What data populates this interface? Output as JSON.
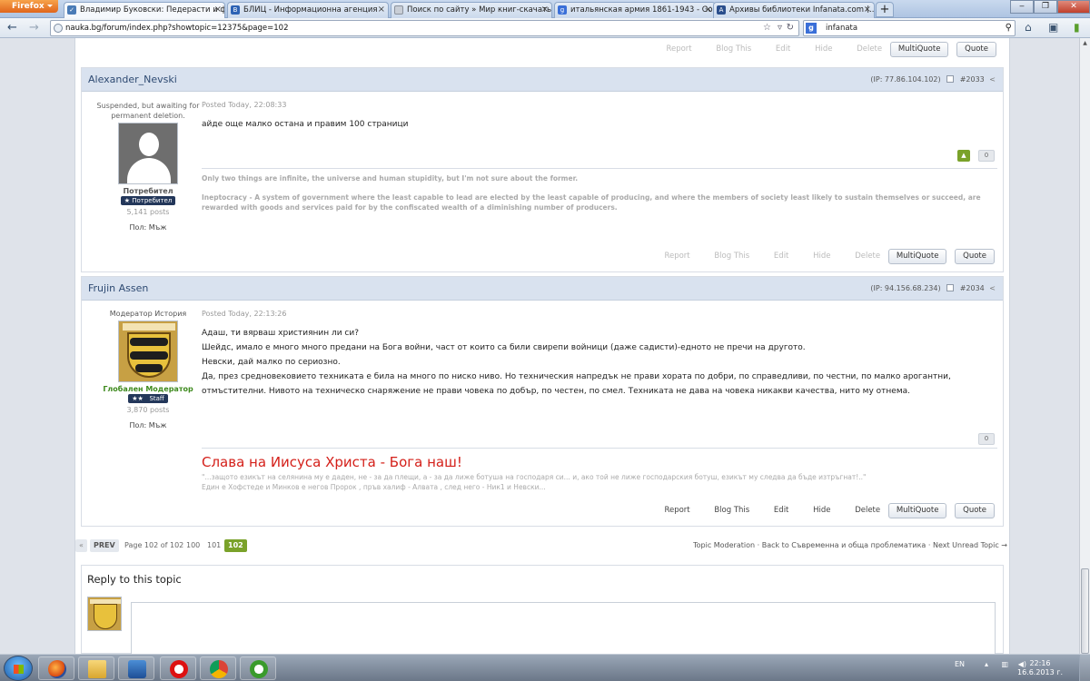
{
  "browser": {
    "app_button": "Firefox",
    "tabs": [
      {
        "label": "Владимир Буковски: Педерасти и ф...",
        "active": true
      },
      {
        "label": "БЛИЦ - Информационна агенция",
        "active": false
      },
      {
        "label": "Поиск по сайту » Мир книг-скачать...",
        "active": false
      },
      {
        "label": "итальянская армия 1861-1943 - Goo...",
        "active": false
      },
      {
        "label": "Архивы библиотеки Infanata.com (...",
        "active": false
      }
    ],
    "url": "nauka.bg/forum/index.php?showtopic=12375&page=102",
    "search_value": "infanata",
    "search_engine_icon": "google-icon"
  },
  "top_actions": {
    "report": "Report",
    "blog": "Blog This",
    "edit": "Edit",
    "hide": "Hide",
    "delete": "Delete",
    "multiquote": "MultiQuote",
    "quote": "Quote"
  },
  "posts": [
    {
      "author": "Alexander_Nevski",
      "ip": "(IP: 77.86.104.102)",
      "number": "#2033",
      "status": "Suspended, but awaiting for permanent deletion.",
      "group": "Потребител",
      "badge": "Потребител",
      "post_count": "5,141 posts",
      "gender": "Пол: Мъж",
      "posted": "Posted Today, 22:08:33",
      "lines": [
        "айде още малко остана и правим 100 страници"
      ],
      "rep_count": "0",
      "signature": [
        "Only two things are infinite, the universe and human stupidity, but I'm not sure about the former.",
        "Ineptocracy - A system of government where the least capable to lead are elected by the least capable of producing, and where the members of society least likely to sustain themselves or succeed, are rewarded with goods and services paid for by the confiscated wealth of a diminishing number of producers."
      ],
      "actions": {
        "report": "Report",
        "blog": "Blog This",
        "edit": "Edit",
        "hide": "Hide",
        "delete": "Delete",
        "multiquote": "MultiQuote",
        "quote": "Quote"
      }
    },
    {
      "author": "Frujin Assen",
      "ip": "(IP: 94.156.68.234)",
      "number": "#2034",
      "title": "Модератор История",
      "group": "Глобален Модератор",
      "badge": "Staff",
      "post_count": "3,870 posts",
      "gender": "Пол: Мъж",
      "posted": "Posted Today, 22:13:26",
      "lines": [
        "Адаш, ти вярваш християнин ли си?",
        "Шейдс, имало е много много предани на Бога войни, част от които са били свирепи войници (даже садисти)-едното не пречи на другото.",
        "Невски, дай малко по сериозно.",
        "Да, през средновековието техниката е била на много по ниско ниво. Но техническия напредък не прави хората по добри, по справедливи, по честни, по малко арогантни,",
        "отмъстителни. Нивото на техническо снаряжение не прави човека по добър, по честен, по смел. Техниката не дава на човека никакви качества, нито му отнема."
      ],
      "rep_count": "0",
      "signature_title": "Слава на Иисуса Христа - Бога наш!",
      "signature": [
        "\"...защото езикът на селянина му е даден, не - за да плещи, а - за да лиже ботуша на господаря си... и, ако той не лиже господарския ботуш, езикът му следва да бъде изтръгнат!..\"",
        "Един е Хофстеде и Минков е негов Пророк , пръв халиф - Алвата , след него - Ник1 и Невски..."
      ],
      "actions": {
        "report": "Report",
        "blog": "Blog This",
        "edit": "Edit",
        "hide": "Hide",
        "delete": "Delete",
        "multiquote": "MultiQuote",
        "quote": "Quote"
      }
    }
  ],
  "pagination": {
    "first": "«",
    "prev": "PREV",
    "page_info": "Page 102 of 102",
    "pages": [
      "100",
      "101",
      "102"
    ],
    "current": "102",
    "links": [
      "Topic Moderation",
      "Back to Съвременна и обща проблематика",
      "Next Unread Topic →"
    ]
  },
  "reply": {
    "title": "Reply to this topic"
  },
  "taskbar": {
    "lang": "EN",
    "time": "22:16",
    "date": "16.6.2013 г."
  },
  "colors": {
    "header_bg": "#d9e2ef",
    "username": "#2e4a72",
    "rep_up": "#7aa22a",
    "page_current": "#7aa22a",
    "sig_title": "#d4201a"
  }
}
